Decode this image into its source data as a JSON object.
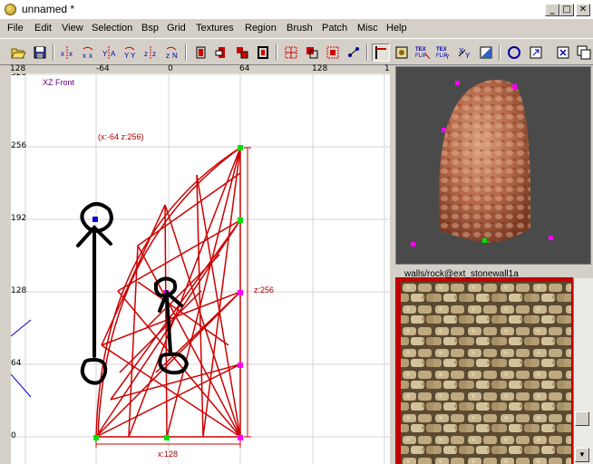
{
  "window": {
    "title": "unnamed *",
    "min_glyph": "_",
    "max_glyph": "□",
    "close_glyph": "✕"
  },
  "menu": [
    "File",
    "Edit",
    "View",
    "Selection",
    "Bsp",
    "Grid",
    "Textures",
    "Region",
    "Brush",
    "Patch",
    "Misc",
    "Help"
  ],
  "toolbar": {
    "labels": {
      "tex_left": "TEX\nFLIP",
      "tex_right": "TEX\nFLIP",
      "xy": "XY"
    }
  },
  "xz_view": {
    "name": "XZ Front",
    "ruler_top": [
      "128",
      "-64",
      "0",
      "64",
      "128",
      "1"
    ],
    "ruler_left": [
      "320",
      "256",
      "192",
      "128",
      "64",
      "0"
    ],
    "size_top": "(x:-64  z:256)",
    "size_right": "z:256",
    "size_bottom": "x:128"
  },
  "texture_view": {
    "label": "walls/rock@ext_stonewall1a"
  },
  "colors": {
    "brush_red": "#cc0000",
    "vertex_green": "#00e000",
    "vertex_magenta": "#ff00ff",
    "grid": "#d6d6d6",
    "selection_frame": "#c00000"
  }
}
